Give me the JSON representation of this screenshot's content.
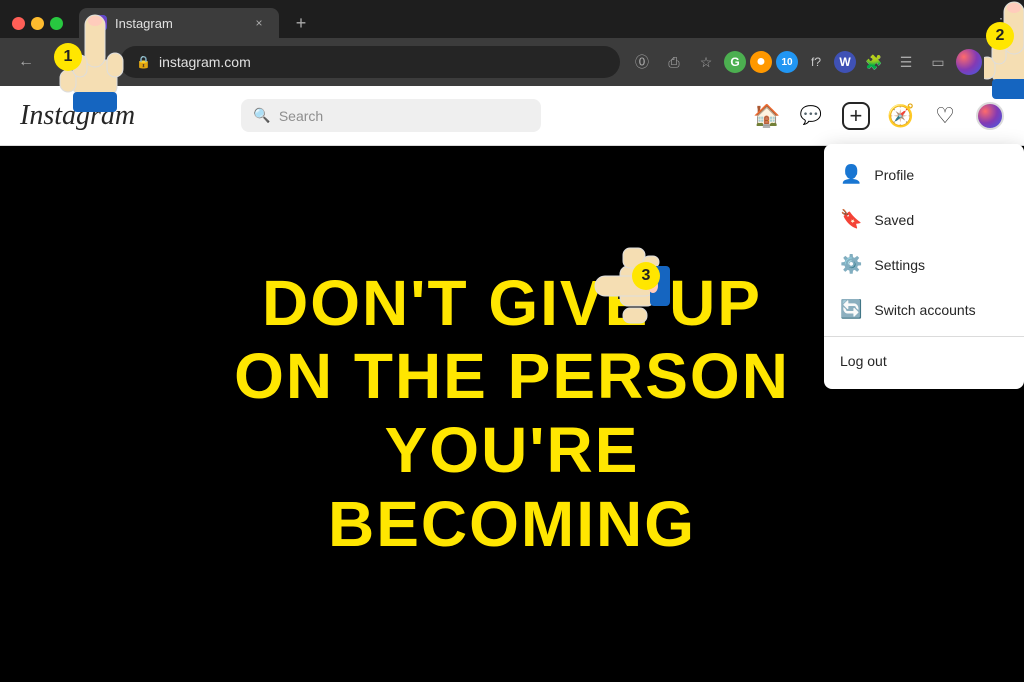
{
  "browser": {
    "tab": {
      "favicon": "instagram-icon",
      "title": "Instagram",
      "close_label": "×"
    },
    "new_tab_label": "+",
    "more_label": "⋮",
    "nav": {
      "back_label": "←",
      "forward_label": "→",
      "refresh_label": "↻"
    },
    "address_bar": {
      "url": "instagram.com",
      "lock_icon": "🔒"
    },
    "extensions": [
      {
        "label": "G",
        "color": "green",
        "name": "google-ext"
      },
      {
        "label": "●",
        "color": "orange",
        "name": "orange-ext"
      },
      {
        "label": "10",
        "color": "blue",
        "name": "ubblock-ext"
      },
      {
        "label": "f?",
        "color": "dark",
        "name": "font-ext"
      },
      {
        "label": "W",
        "color": "blue",
        "name": "w-ext"
      },
      {
        "label": "🧩",
        "color": "dark",
        "name": "puzzle-ext"
      },
      {
        "label": "≡",
        "color": "dark",
        "name": "menu-ext"
      },
      {
        "label": "▭",
        "color": "dark",
        "name": "split-ext"
      }
    ]
  },
  "instagram": {
    "logo": "Instagram",
    "search": {
      "placeholder": "Search",
      "icon": "search-icon"
    },
    "nav_icons": {
      "home": "🏠",
      "messenger": "💬",
      "create": "➕",
      "explore": "🧭",
      "heart": "♡"
    },
    "dropdown_menu": {
      "items": [
        {
          "label": "Profile",
          "icon": "👤"
        },
        {
          "label": "Saved",
          "icon": "🔖"
        },
        {
          "label": "Settings",
          "icon": "⚙️"
        },
        {
          "label": "Switch accounts",
          "icon": "🔄"
        }
      ],
      "logout_label": "Log out"
    }
  },
  "content": {
    "lines": [
      "DON'T GIVE UP",
      "ON THE PERSON",
      "YOU'RE",
      "BECOMING"
    ]
  },
  "annotations": [
    {
      "number": "1",
      "label": "pointer-1"
    },
    {
      "number": "2",
      "label": "pointer-2"
    },
    {
      "number": "3",
      "label": "pointer-3"
    }
  ]
}
